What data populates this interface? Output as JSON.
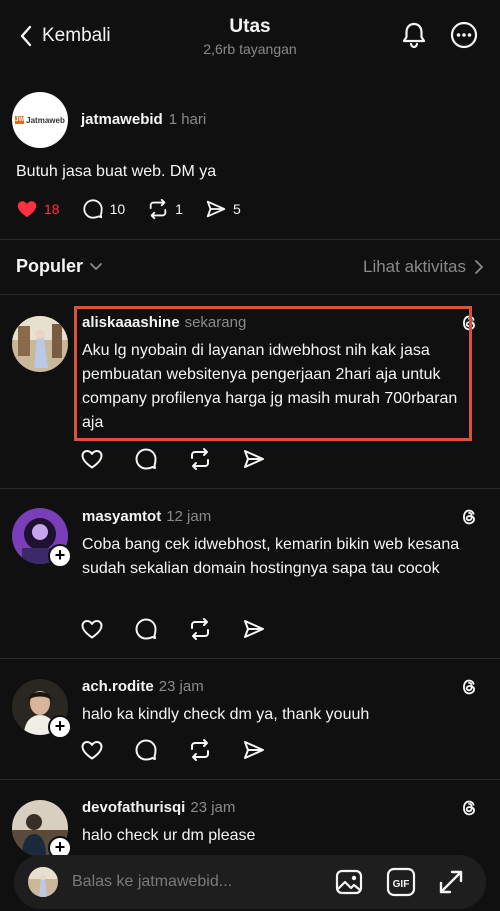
{
  "header": {
    "back_label": "Kembali",
    "title": "Utas",
    "subtitle": "2,6rb tayangan",
    "bell_icon": "bell-icon",
    "more_icon": "more-icon"
  },
  "original_post": {
    "username": "jatmawebid",
    "time": "1 hari",
    "avatar_logo_text": "Jatmaweb",
    "text": "Butuh jasa buat web. DM ya",
    "likes": "18",
    "comments": "10",
    "reposts": "1",
    "shares": "5",
    "like_color": "#ff3040"
  },
  "sort": {
    "label": "Populer",
    "activity_label": "Lihat aktivitas"
  },
  "replies": [
    {
      "username": "aliskaaashine",
      "time": "sekarang",
      "text": "Aku lg nyobain di layanan idwebhost nih kak jasa pembuatan websitenya pengerjaan 2hari aja untuk company profilenya harga jg masih murah 700rbaran aja",
      "highlight_color": "#d9533b"
    },
    {
      "username": "masyamtot",
      "time": "12 jam",
      "text": "Coba bang cek idwebhost, kemarin bikin web kesana sudah sekalian domain hostingnya sapa tau cocok"
    },
    {
      "username": "ach.rodite",
      "time": "23 jam",
      "text": "halo ka kindly check dm ya, thank youuh"
    },
    {
      "username": "devofathurisqi",
      "time": "23 jam",
      "text": "halo check ur dm please"
    }
  ],
  "reply_bar": {
    "placeholder": "Balas ke jatmawebid...",
    "gif_label": "GIF"
  }
}
